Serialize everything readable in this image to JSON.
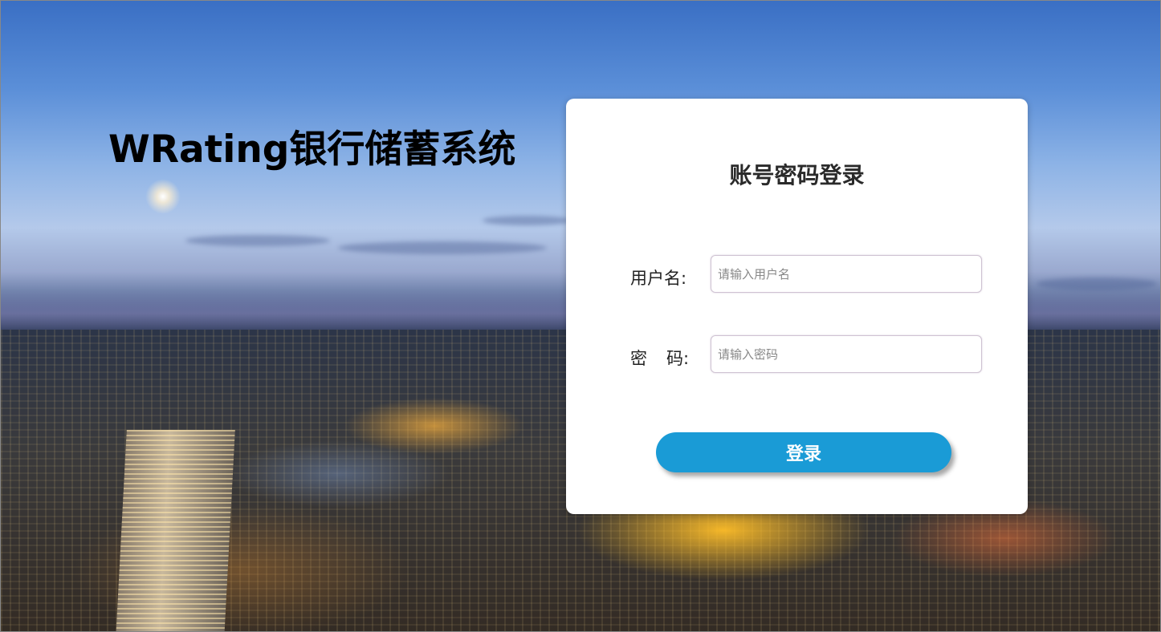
{
  "site": {
    "title": "WRating银行储蓄系统"
  },
  "login": {
    "title": "账号密码登录",
    "username_label": "用户名:",
    "username_placeholder": "请输入用户名",
    "password_label_first": "密",
    "password_label_second": "码:",
    "password_placeholder": "请输入密码",
    "submit_label": "登录"
  },
  "colors": {
    "button": "#1a9bd6",
    "card": "#ffffff",
    "title_text": "#000000"
  }
}
